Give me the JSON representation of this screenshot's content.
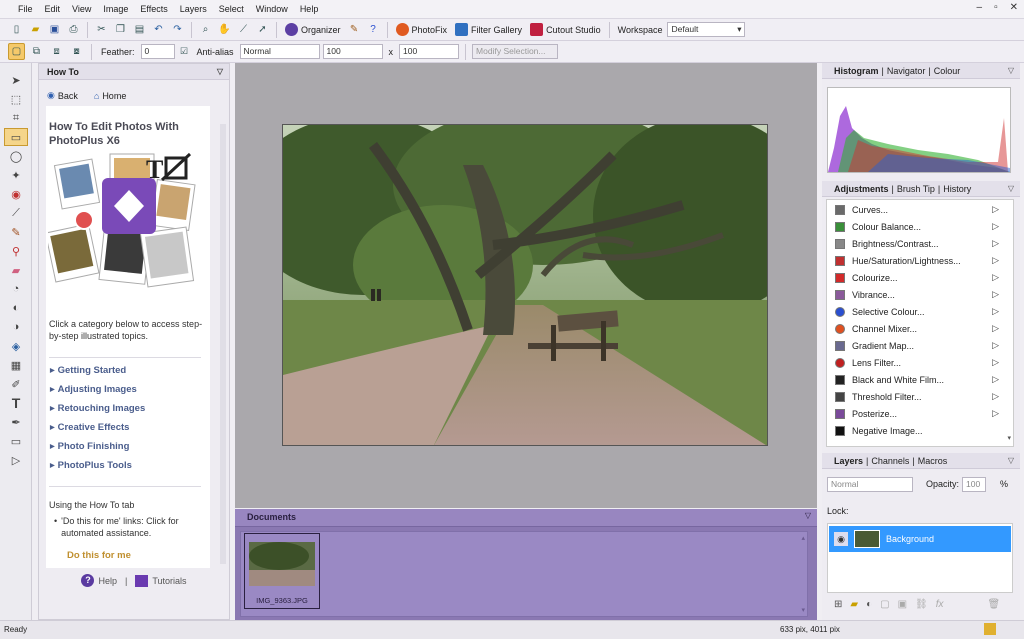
{
  "menu": [
    "File",
    "Edit",
    "View",
    "Image",
    "Effects",
    "Layers",
    "Select",
    "Window",
    "Help"
  ],
  "toolbar": {
    "organizer": "Organizer",
    "photofix": "PhotoFix",
    "filter_gallery": "Filter Gallery",
    "cutout_studio": "Cutout Studio",
    "workspace_label": "Workspace",
    "workspace_value": "Default"
  },
  "context_bar": {
    "feather_label": "Feather:",
    "feather_value": "0",
    "antialias_label": "Anti-alias",
    "blend_value": "Normal",
    "width_value": "100",
    "x_sep": "x",
    "height_value": "100",
    "modify_selection": "Modify Selection..."
  },
  "howto": {
    "tab": "How To",
    "back": "Back",
    "home": "Home",
    "title": "How To Edit Photos With PhotoPlus X6",
    "intro": "Click a category below to access step-by-step illustrated topics.",
    "categories": [
      "Getting Started",
      "Adjusting Images",
      "Retouching Images",
      "Creative Effects",
      "Photo Finishing",
      "PhotoPlus Tools"
    ],
    "using_heading": "Using the How To tab",
    "bullet": "'Do this for me' links: Click for automated assistance.",
    "do_this": "Do this for me",
    "help": "Help",
    "tutorials": "Tutorials",
    "pipe": "|"
  },
  "documents": {
    "title": "Documents",
    "thumb_name": "IMG_9363.JPG"
  },
  "right": {
    "tabs_top": [
      "Histogram",
      "Navigator",
      "Colour"
    ],
    "tabs_mid": [
      "Adjustments",
      "Brush Tip",
      "History"
    ],
    "adjustments": [
      {
        "label": "Curves...",
        "color": "#6a6a6a"
      },
      {
        "label": "Colour Balance...",
        "color": "#3a8f3a"
      },
      {
        "label": "Brightness/Contrast...",
        "color": "#888888"
      },
      {
        "label": "Hue/Saturation/Lightness...",
        "color": "#c03030"
      },
      {
        "label": "Colourize...",
        "color": "#d22a2a"
      },
      {
        "label": "Vibrance...",
        "color": "#8a5a9a"
      },
      {
        "label": "Selective Colour...",
        "color": "#2a4fd0"
      },
      {
        "label": "Channel Mixer...",
        "color": "#e05020"
      },
      {
        "label": "Gradient Map...",
        "color": "#6a6a90"
      },
      {
        "label": "Lens Filter...",
        "color": "#c02020"
      },
      {
        "label": "Black and White Film...",
        "color": "#222222"
      },
      {
        "label": "Threshold Filter...",
        "color": "#444444"
      },
      {
        "label": "Posterize...",
        "color": "#7a4a9a"
      },
      {
        "label": "Negative Image...",
        "color": "#111111"
      }
    ],
    "tabs_bottom": [
      "Layers",
      "Channels",
      "Macros"
    ],
    "layer_blend": "Normal",
    "opacity_label": "Opacity:",
    "opacity_value": "100",
    "opacity_unit": "%",
    "lock_label": "Lock:",
    "layer_name": "Background",
    "accent": "#3399ff"
  },
  "status": {
    "left": "Ready",
    "dims": "633 pix, 4011 pix"
  }
}
